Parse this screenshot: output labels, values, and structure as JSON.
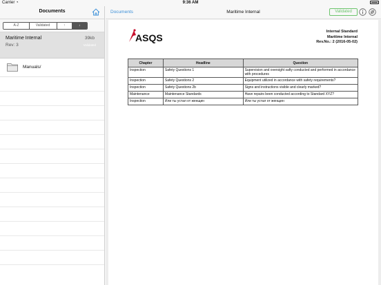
{
  "status_bar": {
    "carrier": "Carrier",
    "time": "9:36 AM"
  },
  "sidebar": {
    "title": "Documents",
    "filters": {
      "az": "A-Z",
      "validated": "Validated",
      "up": "↑",
      "down": "↓"
    },
    "documents": [
      {
        "name": "Maritime Internal",
        "revision": "Rev: 3",
        "size": "39kb",
        "status": "Validated"
      }
    ],
    "folders": [
      {
        "label": "Manuals/"
      }
    ]
  },
  "toolbar": {
    "back_label": "Documents",
    "title": "Maritime Internal",
    "validated_label": "Validated"
  },
  "document": {
    "logo_text": "ASQS",
    "header": {
      "line1": "Internal Standard",
      "line2": "Maritime Internal",
      "line3": "Rev.No.: 2 (2016-05-02)"
    },
    "table": {
      "columns": [
        "Chapter",
        "Headline",
        "Question"
      ],
      "rows": [
        [
          "Inspection",
          "Safety Questions 1",
          "Supervision and oversight safty conducted and performed in accordance with procedures"
        ],
        [
          "Inspection",
          "Safety Questions 2",
          "Equipment utilized in accordance with safety requirements?"
        ],
        [
          "Inspection",
          "Safety Questions 2b",
          "Signs and instructions visible and clearly marked?"
        ],
        [
          "Maintenance",
          "Maintenance Standards",
          "Have repairs been conducted according to Standard XYZ?"
        ],
        [
          "Inspection",
          "Или ты устал от женщин",
          "Или ты устал от женщин"
        ]
      ]
    }
  },
  "colors": {
    "accent": "#3b8fd8",
    "validated": "#6cc46c",
    "logo_red": "#c8102e"
  }
}
